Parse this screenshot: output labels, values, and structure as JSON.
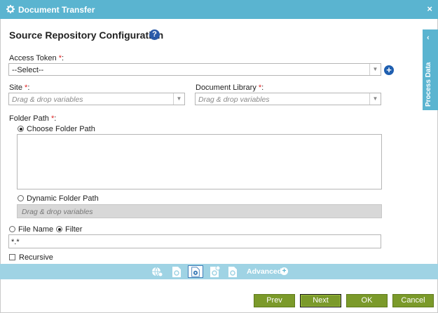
{
  "window": {
    "title": "Document Transfer",
    "close_glyph": "×"
  },
  "heading": "Source Repository Configuration",
  "help_glyph": "?",
  "access_token": {
    "label": "Access Token",
    "required_mark": "*",
    "colon": ":",
    "value": "--Select--"
  },
  "site": {
    "label": "Site",
    "required_mark": "*",
    "colon": ":",
    "placeholder": "Drag & drop variables"
  },
  "document_library": {
    "label": "Document Library",
    "required_mark": "*",
    "colon": ":",
    "placeholder": "Drag & drop variables"
  },
  "folder_path": {
    "label": "Folder Path",
    "required_mark": "*",
    "colon": ":",
    "choose_label": "Choose Folder Path",
    "dynamic_label": "Dynamic Folder Path",
    "dynamic_placeholder": "Drag & drop variables",
    "selected": "choose"
  },
  "file_mode": {
    "file_name_label": "File Name",
    "filter_label": "Filter",
    "selected": "filter",
    "filter_value": "*.*"
  },
  "recursive": {
    "label": "Recursive",
    "checked": false
  },
  "side_panel": {
    "label": "Process Data",
    "chevron": "‹"
  },
  "steps": {
    "icons": [
      "globe-settings-icon",
      "document-settings-icon",
      "disc-settings-icon",
      "document-sync-icon",
      "document-settings-alt-icon"
    ],
    "active_index": 2,
    "advanced_label": "Advanced",
    "advanced_plus": "+"
  },
  "buttons": {
    "prev": "Prev",
    "next": "Next",
    "ok": "OK",
    "cancel": "Cancel"
  },
  "colors": {
    "titlebar": "#5ab4d0",
    "button": "#7b9a2a",
    "stepbar": "#9fd3e4",
    "required": "#dd2222",
    "help": "#2b5aa8"
  }
}
